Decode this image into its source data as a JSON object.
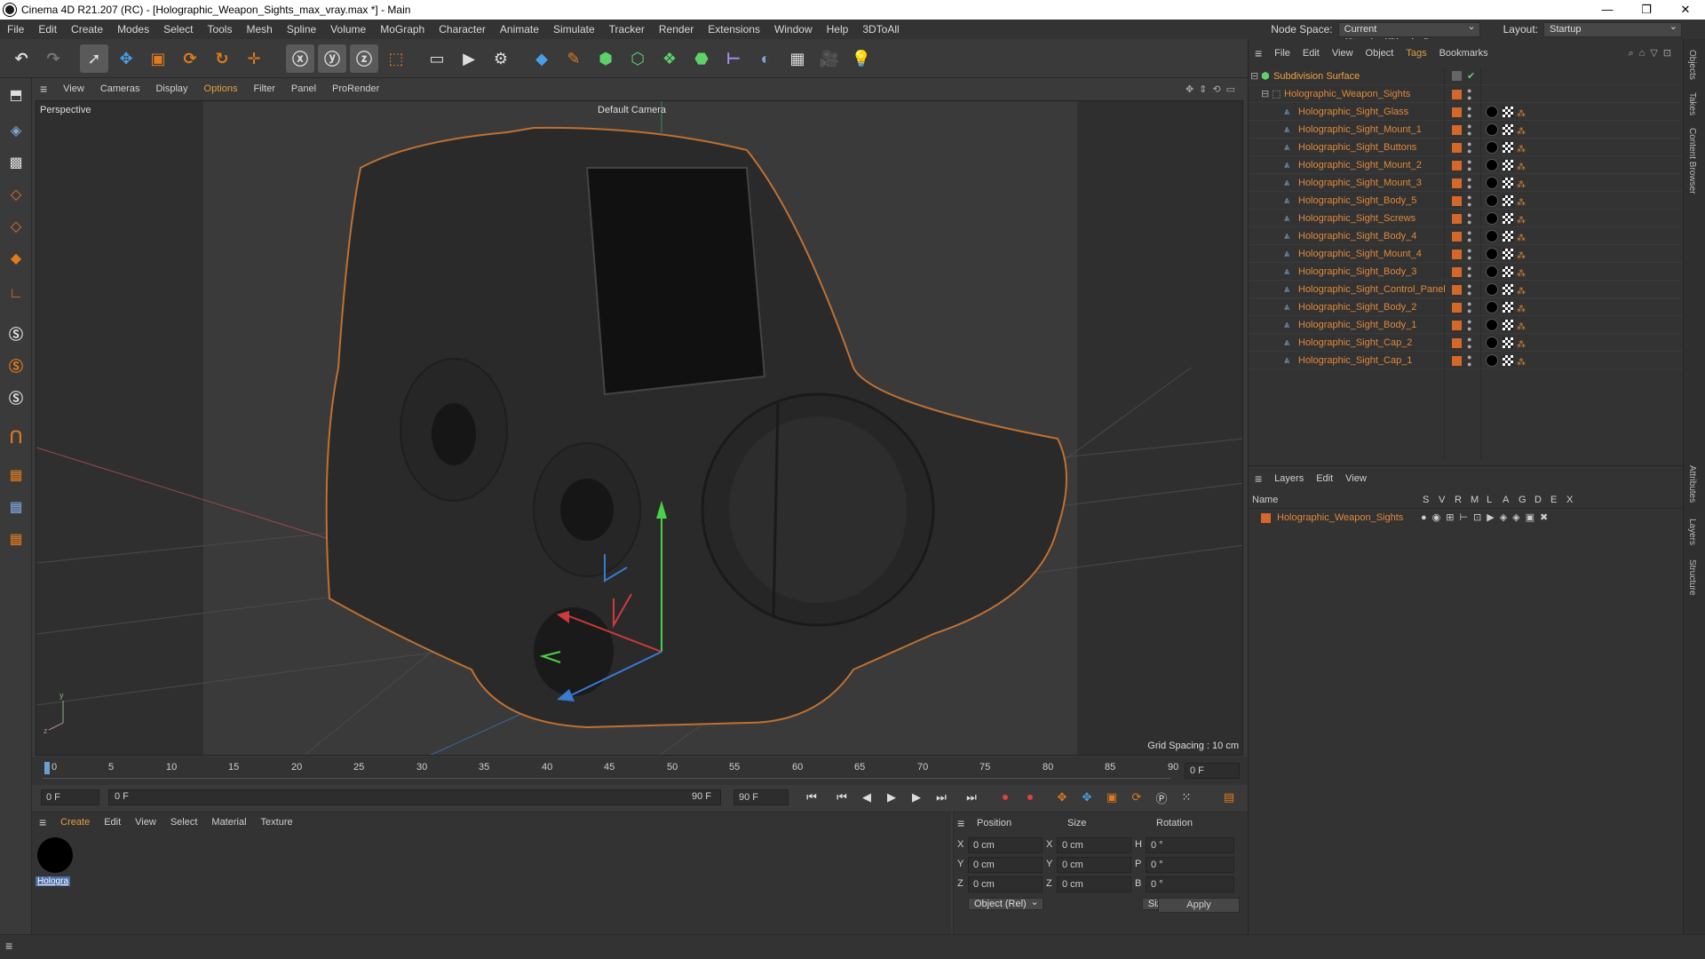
{
  "window": {
    "title": "Cinema 4D R21.207 (RC) - [Holographic_Weapon_Sights_max_vray.max *] - Main",
    "minimize": "—",
    "maximize": "❐",
    "close": "✕"
  },
  "menubar": {
    "items": [
      "File",
      "Edit",
      "Create",
      "Modes",
      "Select",
      "Tools",
      "Mesh",
      "Spline",
      "Volume",
      "MoGraph",
      "Character",
      "Animate",
      "Simulate",
      "Tracker",
      "Render",
      "Extensions",
      "Window",
      "Help",
      "3DToAll"
    ],
    "node_space_label": "Node Space:",
    "node_space_value": "Current (Standard/Physical)",
    "layout_label": "Layout:",
    "layout_value": "Startup"
  },
  "viewport": {
    "menu": [
      "View",
      "Cameras",
      "Display",
      "Options",
      "Filter",
      "Panel",
      "ProRender"
    ],
    "view_name": "Perspective",
    "camera": "Default Camera",
    "grid_spacing": "Grid Spacing : 10 cm"
  },
  "timeline": {
    "ticks": [
      "0",
      "5",
      "10",
      "15",
      "20",
      "25",
      "30",
      "35",
      "40",
      "45",
      "50",
      "55",
      "60",
      "65",
      "70",
      "75",
      "80",
      "85",
      "90"
    ],
    "current_frame": "0 F",
    "start_field": "0 F",
    "range_start": "0 F",
    "range_end": "90 F",
    "end_field": "90 F"
  },
  "material_manager": {
    "menu": [
      "Create",
      "Edit",
      "View",
      "Select",
      "Material",
      "Texture"
    ],
    "material_name": "Hologra"
  },
  "coordinates": {
    "headers": [
      "Position",
      "Size",
      "Rotation"
    ],
    "rows": [
      {
        "axis": "X",
        "pos": "0 cm",
        "size_axis": "X",
        "size": "0 cm",
        "rot_axis": "H",
        "rot": "0 °"
      },
      {
        "axis": "Y",
        "pos": "0 cm",
        "size_axis": "Y",
        "size": "0 cm",
        "rot_axis": "P",
        "rot": "0 °"
      },
      {
        "axis": "Z",
        "pos": "0 cm",
        "size_axis": "Z",
        "size": "0 cm",
        "rot_axis": "B",
        "rot": "0 °"
      }
    ],
    "mode": "Object (Rel)",
    "size_mode": "Size",
    "apply": "Apply"
  },
  "object_manager": {
    "menu": [
      "File",
      "Edit",
      "View",
      "Object",
      "Tags",
      "Bookmarks"
    ],
    "root": "Subdivision Surface",
    "group": "Holographic_Weapon_Sights",
    "objects": [
      "Holographic_Sight_Glass",
      "Holographic_Sight_Mount_1",
      "Holographic_Sight_Buttons",
      "Holographic_Sight_Mount_2",
      "Holographic_Sight_Mount_3",
      "Holographic_Sight_Body_5",
      "Holographic_Sight_Screws",
      "Holographic_Sight_Body_4",
      "Holographic_Sight_Mount_4",
      "Holographic_Sight_Body_3",
      "Holographic_Sight_Control_Panel",
      "Holographic_Sight_Body_2",
      "Holographic_Sight_Body_1",
      "Holographic_Sight_Cap_2",
      "Holographic_Sight_Cap_1"
    ]
  },
  "layer_manager": {
    "menu": [
      "Layers",
      "Edit",
      "View"
    ],
    "name_header": "Name",
    "flags": [
      "S",
      "V",
      "R",
      "M",
      "L",
      "A",
      "G",
      "D",
      "E",
      "X"
    ],
    "layer_name": "Holographic_Weapon_Sights"
  },
  "side_tabs": [
    "Objects",
    "Takes",
    "Content Browser",
    "Attributes",
    "Layers",
    "Structure"
  ],
  "colors": {
    "accent_orange": "#e0883a",
    "selection_orange": "#d4682a",
    "panel_bg": "#333333",
    "viewport_bg": "#363636"
  }
}
